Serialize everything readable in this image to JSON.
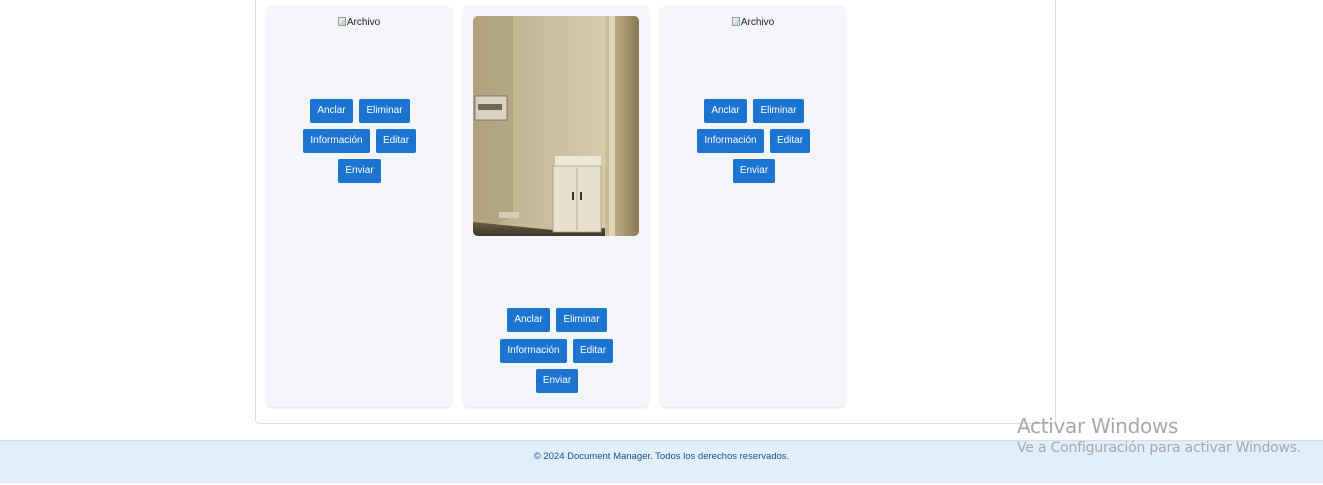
{
  "cards": [
    {
      "image_alt": "Archivo",
      "buttons": {
        "pin": "Anclar",
        "delete": "Eliminar",
        "info": "Información",
        "edit": "Editar",
        "send": "Enviar"
      }
    },
    {
      "image_kind": "photo",
      "buttons": {
        "pin": "Anclar",
        "delete": "Eliminar",
        "info": "Información",
        "edit": "Editar",
        "send": "Enviar"
      }
    },
    {
      "image_alt": "Archivo",
      "buttons": {
        "pin": "Anclar",
        "delete": "Eliminar",
        "info": "Información",
        "edit": "Editar",
        "send": "Enviar"
      }
    }
  ],
  "footer": {
    "copyright": "© 2024 Document Manager. Todos los derechos reservados."
  },
  "watermark": {
    "title": "Activar Windows",
    "subtitle": "Ve a Configuración para activar Windows."
  },
  "colors": {
    "button": "#1c74d2",
    "card_bg": "#f3f5f8",
    "footer_bg": "#e1effb",
    "footer_text": "#1d4f8c"
  }
}
